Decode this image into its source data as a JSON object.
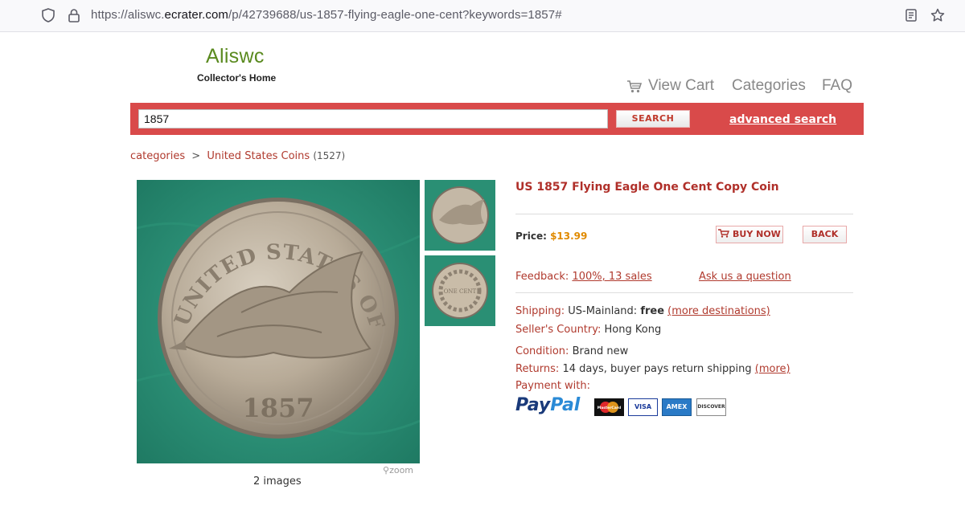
{
  "browser": {
    "url_prefix": "https://aliswc.",
    "url_domain": "ecrater.com",
    "url_path": "/p/42739688/us-1857-flying-eagle-one-cent?keywords=1857#"
  },
  "site": {
    "logo": "Aliswc",
    "tagline": "Collector's Home"
  },
  "topnav": {
    "view_cart": "View Cart",
    "categories": "Categories",
    "faq": "FAQ"
  },
  "search": {
    "value": "1857",
    "button": "SEARCH",
    "advanced": "advanced search"
  },
  "breadcrumb": {
    "root": "categories",
    "separator": ">",
    "current": "United States Coins",
    "count": "(1527)"
  },
  "gallery": {
    "zoom": "zoom",
    "image_count": "2 images",
    "coin_legend": "UNITED STATES OF AMERICA",
    "coin_year": "1857",
    "reverse_text": "ONE CENT"
  },
  "product": {
    "title": "US 1857 Flying Eagle One Cent Copy Coin",
    "price_label": "Price:",
    "price": "$13.99",
    "buy_now": "BUY NOW",
    "back": "BACK",
    "feedback_label": "Feedback:",
    "feedback_value": "100%, 13 sales",
    "ask_question": "Ask us a question",
    "shipping_label": "Shipping:",
    "shipping_region": "US-Mainland:",
    "shipping_value": "free",
    "shipping_more": "(more destinations)",
    "country_label": "Seller's Country:",
    "country_value": "Hong Kong",
    "condition_label": "Condition:",
    "condition_value": "Brand new",
    "returns_label": "Returns:",
    "returns_value": "14 days, buyer pays return shipping",
    "returns_more": "(more)",
    "payment_label": "Payment with:",
    "paypal_1": "Pay",
    "paypal_2": "Pal",
    "cards": [
      "MasterCard",
      "VISA",
      "AMEX",
      "DISCOVER"
    ]
  }
}
